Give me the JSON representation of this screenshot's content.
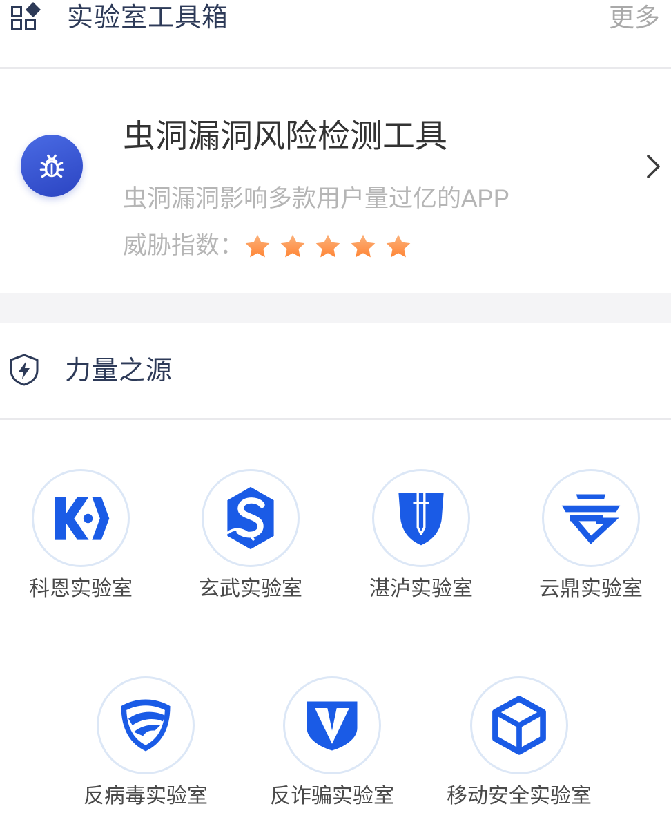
{
  "header": {
    "icon": "apps-grid-icon",
    "title": "实验室工具箱",
    "more": "更多"
  },
  "feature": {
    "icon": "bug-icon",
    "title": "虫洞漏洞风险检测工具",
    "subtitle": "虫洞漏洞影响多款用户量过亿的APP",
    "threat_label": "威胁指数：",
    "threat_level": 5,
    "threat_max": 5,
    "star_icon": "star-icon",
    "action_icon": "chevron-right-icon"
  },
  "section": {
    "icon": "shield-lightning-icon",
    "title": "力量之源"
  },
  "labs": [
    {
      "name": "科恩实验室",
      "icon": "keen-lab-logo"
    },
    {
      "name": "玄武实验室",
      "icon": "xuanwu-lab-logo"
    },
    {
      "name": "湛泸实验室",
      "icon": "zhanlu-lab-logo"
    },
    {
      "name": "云鼎实验室",
      "icon": "yunding-lab-logo"
    },
    {
      "name": "反病毒实验室",
      "icon": "anti-virus-lab-logo"
    },
    {
      "name": "反诈骗实验室",
      "icon": "anti-fraud-lab-logo"
    },
    {
      "name": "移动安全实验室",
      "icon": "mobile-security-lab-logo"
    }
  ],
  "colors": {
    "accent": "#1a5be6",
    "navy": "#2d3a58",
    "title": "#333333",
    "muted": "#b5b5b5",
    "label": "#4a4a4a",
    "more": "#a9a9a9",
    "band": "#f4f4f6",
    "divider": "#e9e9ec",
    "ring": "#dce7f6",
    "badge_top": "#4a6be4",
    "badge_bottom": "#2b44c2",
    "star_light": "#fbb27c",
    "star_dark": "#ff8636"
  }
}
